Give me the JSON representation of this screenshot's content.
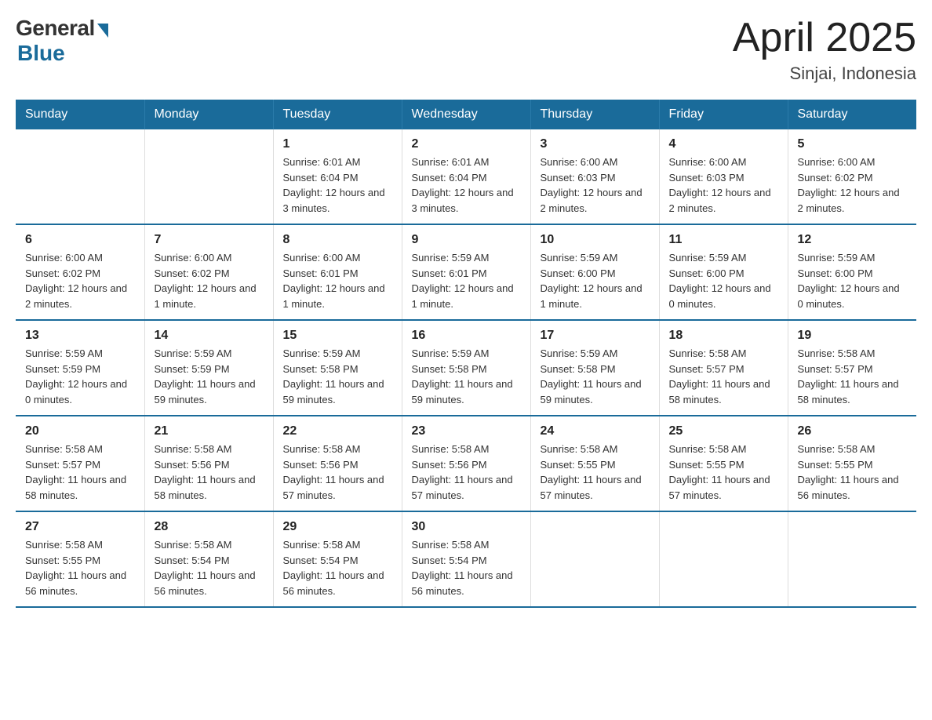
{
  "header": {
    "logo_general": "General",
    "logo_blue": "Blue",
    "title": "April 2025",
    "subtitle": "Sinjai, Indonesia"
  },
  "days_of_week": [
    "Sunday",
    "Monday",
    "Tuesday",
    "Wednesday",
    "Thursday",
    "Friday",
    "Saturday"
  ],
  "weeks": [
    [
      {
        "day": "",
        "info": ""
      },
      {
        "day": "",
        "info": ""
      },
      {
        "day": "1",
        "info": "Sunrise: 6:01 AM\nSunset: 6:04 PM\nDaylight: 12 hours\nand 3 minutes."
      },
      {
        "day": "2",
        "info": "Sunrise: 6:01 AM\nSunset: 6:04 PM\nDaylight: 12 hours\nand 3 minutes."
      },
      {
        "day": "3",
        "info": "Sunrise: 6:00 AM\nSunset: 6:03 PM\nDaylight: 12 hours\nand 2 minutes."
      },
      {
        "day": "4",
        "info": "Sunrise: 6:00 AM\nSunset: 6:03 PM\nDaylight: 12 hours\nand 2 minutes."
      },
      {
        "day": "5",
        "info": "Sunrise: 6:00 AM\nSunset: 6:02 PM\nDaylight: 12 hours\nand 2 minutes."
      }
    ],
    [
      {
        "day": "6",
        "info": "Sunrise: 6:00 AM\nSunset: 6:02 PM\nDaylight: 12 hours\nand 2 minutes."
      },
      {
        "day": "7",
        "info": "Sunrise: 6:00 AM\nSunset: 6:02 PM\nDaylight: 12 hours\nand 1 minute."
      },
      {
        "day": "8",
        "info": "Sunrise: 6:00 AM\nSunset: 6:01 PM\nDaylight: 12 hours\nand 1 minute."
      },
      {
        "day": "9",
        "info": "Sunrise: 5:59 AM\nSunset: 6:01 PM\nDaylight: 12 hours\nand 1 minute."
      },
      {
        "day": "10",
        "info": "Sunrise: 5:59 AM\nSunset: 6:00 PM\nDaylight: 12 hours\nand 1 minute."
      },
      {
        "day": "11",
        "info": "Sunrise: 5:59 AM\nSunset: 6:00 PM\nDaylight: 12 hours\nand 0 minutes."
      },
      {
        "day": "12",
        "info": "Sunrise: 5:59 AM\nSunset: 6:00 PM\nDaylight: 12 hours\nand 0 minutes."
      }
    ],
    [
      {
        "day": "13",
        "info": "Sunrise: 5:59 AM\nSunset: 5:59 PM\nDaylight: 12 hours\nand 0 minutes."
      },
      {
        "day": "14",
        "info": "Sunrise: 5:59 AM\nSunset: 5:59 PM\nDaylight: 11 hours\nand 59 minutes."
      },
      {
        "day": "15",
        "info": "Sunrise: 5:59 AM\nSunset: 5:58 PM\nDaylight: 11 hours\nand 59 minutes."
      },
      {
        "day": "16",
        "info": "Sunrise: 5:59 AM\nSunset: 5:58 PM\nDaylight: 11 hours\nand 59 minutes."
      },
      {
        "day": "17",
        "info": "Sunrise: 5:59 AM\nSunset: 5:58 PM\nDaylight: 11 hours\nand 59 minutes."
      },
      {
        "day": "18",
        "info": "Sunrise: 5:58 AM\nSunset: 5:57 PM\nDaylight: 11 hours\nand 58 minutes."
      },
      {
        "day": "19",
        "info": "Sunrise: 5:58 AM\nSunset: 5:57 PM\nDaylight: 11 hours\nand 58 minutes."
      }
    ],
    [
      {
        "day": "20",
        "info": "Sunrise: 5:58 AM\nSunset: 5:57 PM\nDaylight: 11 hours\nand 58 minutes."
      },
      {
        "day": "21",
        "info": "Sunrise: 5:58 AM\nSunset: 5:56 PM\nDaylight: 11 hours\nand 58 minutes."
      },
      {
        "day": "22",
        "info": "Sunrise: 5:58 AM\nSunset: 5:56 PM\nDaylight: 11 hours\nand 57 minutes."
      },
      {
        "day": "23",
        "info": "Sunrise: 5:58 AM\nSunset: 5:56 PM\nDaylight: 11 hours\nand 57 minutes."
      },
      {
        "day": "24",
        "info": "Sunrise: 5:58 AM\nSunset: 5:55 PM\nDaylight: 11 hours\nand 57 minutes."
      },
      {
        "day": "25",
        "info": "Sunrise: 5:58 AM\nSunset: 5:55 PM\nDaylight: 11 hours\nand 57 minutes."
      },
      {
        "day": "26",
        "info": "Sunrise: 5:58 AM\nSunset: 5:55 PM\nDaylight: 11 hours\nand 56 minutes."
      }
    ],
    [
      {
        "day": "27",
        "info": "Sunrise: 5:58 AM\nSunset: 5:55 PM\nDaylight: 11 hours\nand 56 minutes."
      },
      {
        "day": "28",
        "info": "Sunrise: 5:58 AM\nSunset: 5:54 PM\nDaylight: 11 hours\nand 56 minutes."
      },
      {
        "day": "29",
        "info": "Sunrise: 5:58 AM\nSunset: 5:54 PM\nDaylight: 11 hours\nand 56 minutes."
      },
      {
        "day": "30",
        "info": "Sunrise: 5:58 AM\nSunset: 5:54 PM\nDaylight: 11 hours\nand 56 minutes."
      },
      {
        "day": "",
        "info": ""
      },
      {
        "day": "",
        "info": ""
      },
      {
        "day": "",
        "info": ""
      }
    ]
  ]
}
